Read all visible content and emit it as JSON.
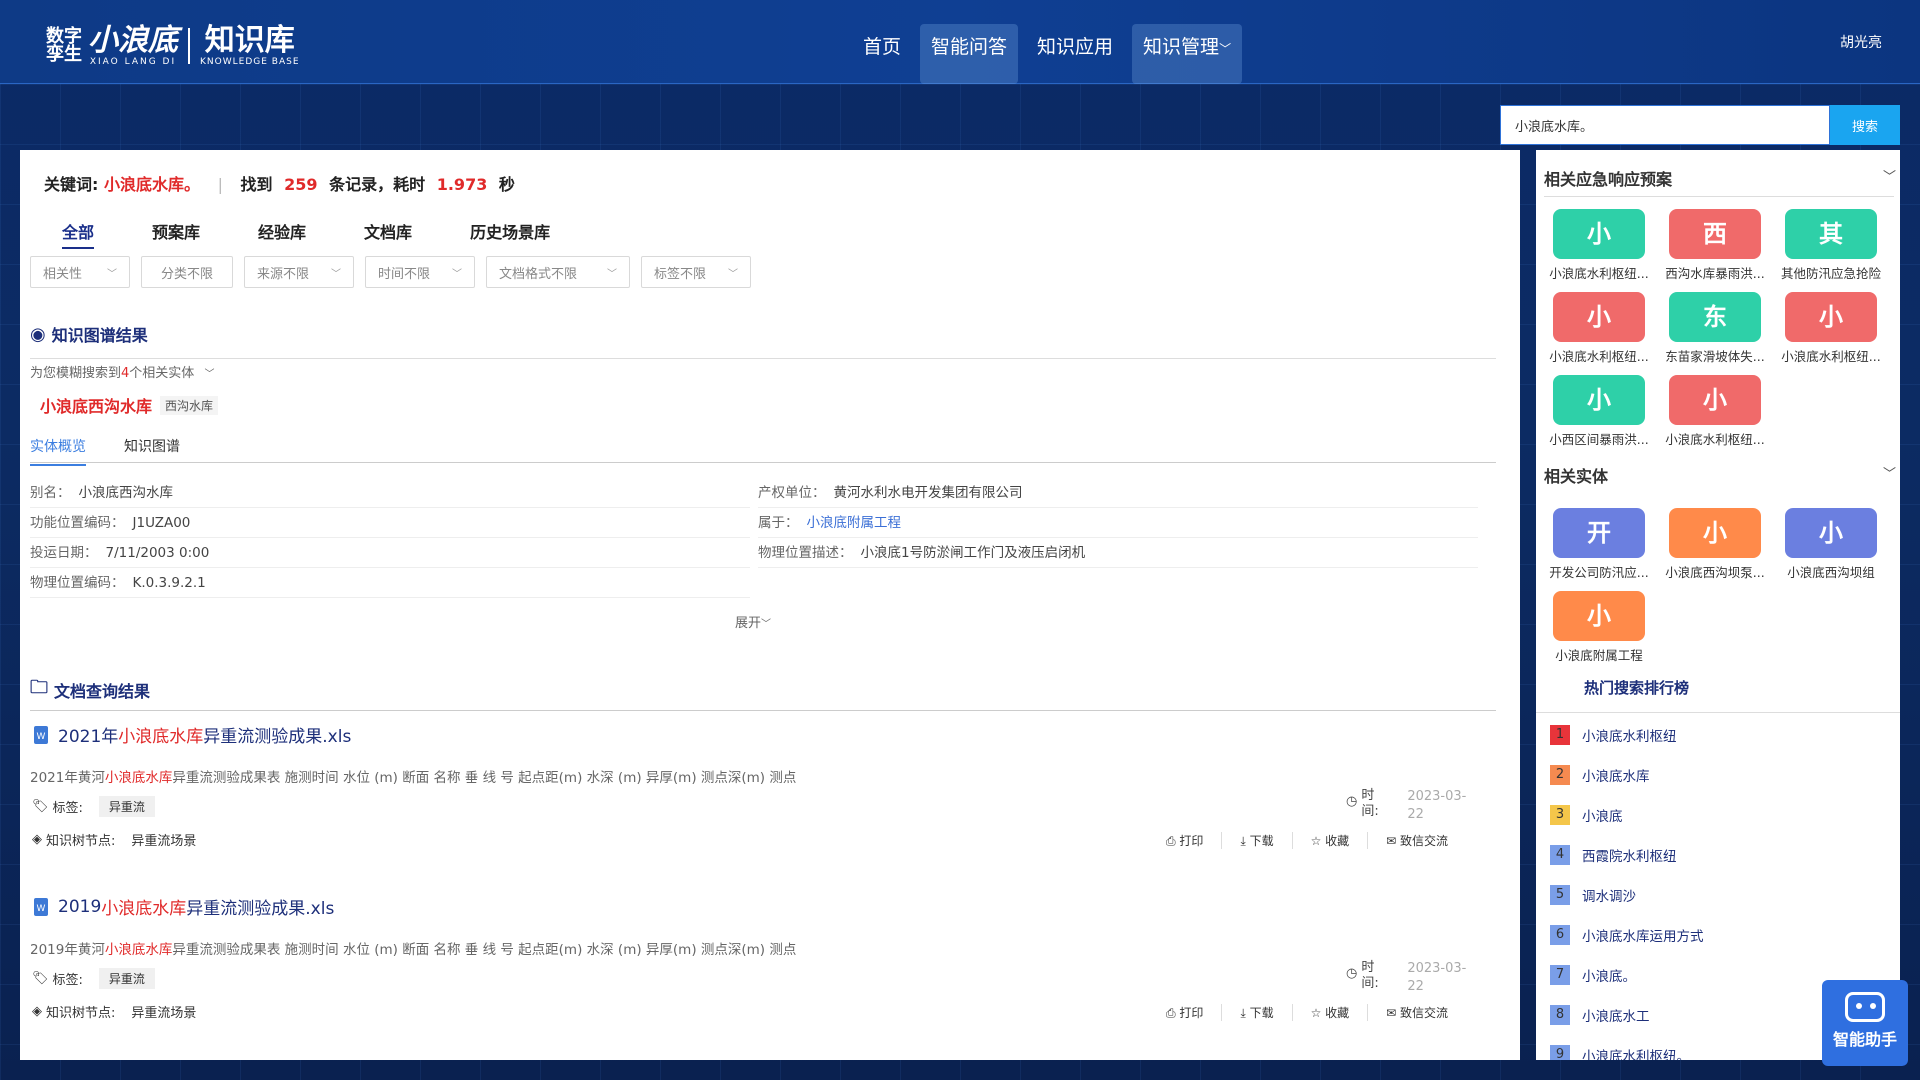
{
  "header": {
    "logo_line1": "数字",
    "logo_line2": "孪生",
    "logo_brand": "小浪底",
    "logo_brand_en": "XIAO LANG DI",
    "logo_kb": "知识库",
    "logo_kb_en": "KNOWLEDGE BASE",
    "nav": [
      "首页",
      "智能问答",
      "知识应用",
      "知识管理"
    ],
    "user": "胡光亮"
  },
  "search": {
    "value": "小浪底水库。",
    "button": "搜索"
  },
  "summary": {
    "keyword_label": "关键词:",
    "keyword": "小浪底水库。",
    "found_label": "找到",
    "count": "259",
    "records_label": "条记录，耗时",
    "time": "1.973",
    "unit": "秒"
  },
  "tabs": [
    "全部",
    "预案库",
    "经验库",
    "文档库",
    "历史场景库"
  ],
  "filters": [
    "相关性",
    "分类不限",
    "来源不限",
    "时间不限",
    "文档格式不限",
    "标签不限"
  ],
  "kg": {
    "title": "知识图谱结果",
    "fuzzy_prefix": "为您模糊搜索到",
    "fuzzy_count": "4",
    "fuzzy_suffix": "个相关实体",
    "entity_name": "小浪底西沟水库",
    "entity_tag": "西沟水库",
    "subtabs": [
      "实体概览",
      "知识图谱"
    ],
    "attrs_left": [
      {
        "k": "别名：",
        "v": "小浪底西沟水库"
      },
      {
        "k": "功能位置编码：",
        "v": "J1UZA00"
      },
      {
        "k": "投运日期：",
        "v": "7/11/2003 0:00"
      },
      {
        "k": "物理位置编码：",
        "v": "K.0.3.9.2.1"
      }
    ],
    "attrs_right": [
      {
        "k": "产权单位：",
        "v": "黄河水利水电开发集团有限公司"
      },
      {
        "k": "属于：",
        "v": "小浪底附属工程"
      },
      {
        "k": "物理位置描述：",
        "v": "小浪底1号防淤闸工作门及液压启闭机"
      }
    ],
    "expand": "展开"
  },
  "docs": {
    "title": "文档查询结果",
    "items": [
      {
        "t_pre": "2021年",
        "t_hl": "小浪底水库",
        "t_post": "异重流测验成果.xls",
        "s_pre": "2021年黄河",
        "s_hl": "小浪底水库",
        "s_post": "异重流测验成果表 施测时间 水位 (m) 断面 名称 垂 线 号 起点距(m) 水深 (m) 异厚(m) 测点深(m) 测点",
        "label": "标签:",
        "tag": "异重流",
        "time_label": "时间:",
        "time": "2023-03-22",
        "node_label": "知识树节点:",
        "node": "异重流场景"
      },
      {
        "t_pre": "2019",
        "t_hl": "小浪底水库",
        "t_post": "异重流测验成果.xls",
        "s_pre": "2019年黄河",
        "s_hl": "小浪底水库",
        "s_post": "异重流测验成果表 施测时间 水位 (m) 断面 名称 垂 线 号 起点距(m) 水深 (m) 异厚(m) 测点深(m) 测点",
        "label": "标签:",
        "tag": "异重流",
        "time_label": "时间:",
        "time": "2023-03-22",
        "node_label": "知识树节点:",
        "node": "异重流场景"
      }
    ],
    "actions": [
      "打印",
      "下载",
      "收藏",
      "致信交流"
    ]
  },
  "side": {
    "emergency_title": "相关应急响应预案",
    "emergency": [
      {
        "ch": "小",
        "cap": "小浪底水利枢纽...",
        "color": "#2ed0a8"
      },
      {
        "ch": "西",
        "cap": "西沟水库暴雨洪...",
        "color": "#f06a6a"
      },
      {
        "ch": "其",
        "cap": "其他防汛应急抢险",
        "color": "#2ed0a8"
      },
      {
        "ch": "小",
        "cap": "小浪底水利枢纽...",
        "color": "#f06a6a"
      },
      {
        "ch": "东",
        "cap": "东苗家滑坡体失...",
        "color": "#2ed0a8"
      },
      {
        "ch": "小",
        "cap": "小浪底水利枢纽...",
        "color": "#f06a6a"
      },
      {
        "ch": "小",
        "cap": "小西区间暴雨洪...",
        "color": "#2ed0a8"
      },
      {
        "ch": "小",
        "cap": "小浪底水利枢纽...",
        "color": "#f06a6a"
      }
    ],
    "entity_title": "相关实体",
    "entities": [
      {
        "ch": "开",
        "cap": "开发公司防汛应...",
        "color": "#6b7fe0"
      },
      {
        "ch": "小",
        "cap": "小浪底西沟坝泵...",
        "color": "#ff8a4a"
      },
      {
        "ch": "小",
        "cap": "小浪底西沟坝组",
        "color": "#6b7fe0"
      },
      {
        "ch": "小",
        "cap": "小浪底附属工程",
        "color": "#ff8a4a"
      }
    ],
    "rank_title": "热门搜索排行榜",
    "ranks": [
      {
        "n": "1",
        "t": "小浪底水利枢纽",
        "color": "#e8343a"
      },
      {
        "n": "2",
        "t": "小浪底水库",
        "color": "#f58a50"
      },
      {
        "n": "3",
        "t": "小浪底",
        "color": "#f4c64a"
      },
      {
        "n": "4",
        "t": "西霞院水利枢纽",
        "color": "#7a9ee8"
      },
      {
        "n": "5",
        "t": "调水调沙",
        "color": "#7a9ee8"
      },
      {
        "n": "6",
        "t": "小浪底水库运用方式",
        "color": "#7a9ee8"
      },
      {
        "n": "7",
        "t": "小浪底。",
        "color": "#7a9ee8"
      },
      {
        "n": "8",
        "t": "小浪底水工",
        "color": "#7a9ee8"
      },
      {
        "n": "9",
        "t": "小浪底水利枢纽。",
        "color": "#7a9ee8"
      }
    ]
  },
  "assistant": {
    "label": "智能助手"
  }
}
